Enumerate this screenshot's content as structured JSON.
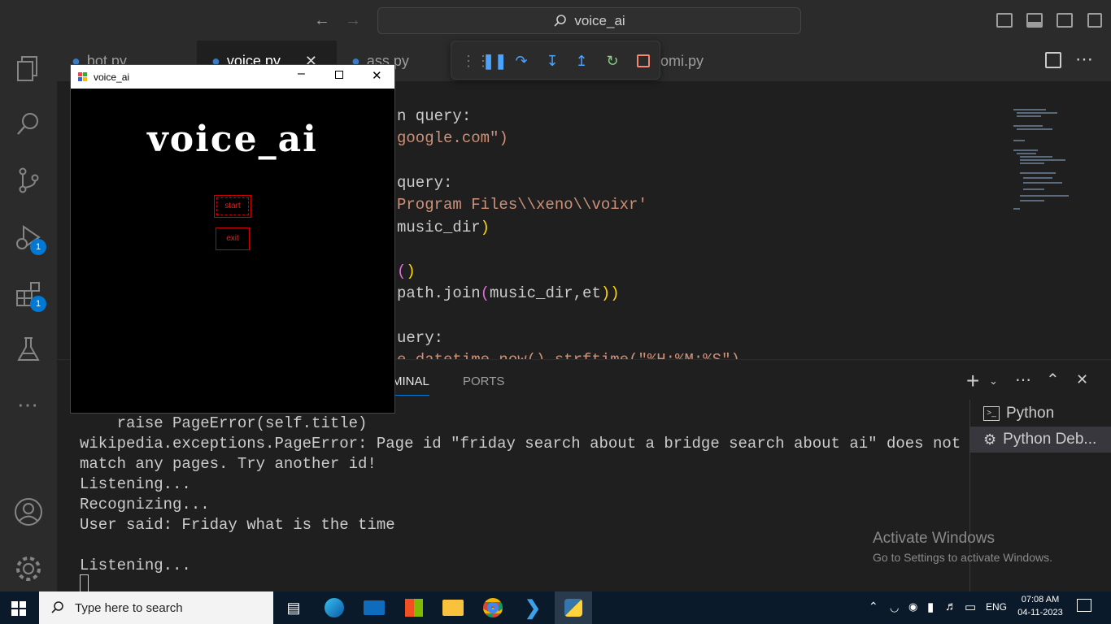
{
  "window_title": "voice_ai",
  "tabs": [
    {
      "label": "bot.py"
    },
    {
      "label": "voice.py"
    },
    {
      "label": "ass.py"
    },
    {
      "label": "omi.py"
    }
  ],
  "editor_lines": [
    {
      "parts": [
        {
          "t": "n query:",
          "c": "w"
        }
      ]
    },
    {
      "parts": [
        {
          "t": "google.com\")",
          "c": "s"
        }
      ]
    },
    {
      "parts": [
        {
          "t": "",
          "c": "w"
        }
      ]
    },
    {
      "parts": [
        {
          "t": "query:",
          "c": "w"
        }
      ]
    },
    {
      "parts": [
        {
          "t": "Program Files\\\\xeno\\\\voixr'",
          "c": "s"
        }
      ]
    },
    {
      "parts": [
        {
          "t": "music_dir",
          "c": "w"
        },
        {
          "t": ")",
          "c": "y"
        }
      ]
    },
    {
      "parts": [
        {
          "t": "",
          "c": "w"
        }
      ]
    },
    {
      "parts": [
        {
          "t": "(",
          "c": "p"
        },
        {
          "t": ")",
          "c": "y"
        }
      ]
    },
    {
      "parts": [
        {
          "t": "path.join",
          "c": "w"
        },
        {
          "t": "(",
          "c": "p"
        },
        {
          "t": "music_dir,et",
          "c": "w"
        },
        {
          "t": "))",
          "c": "y"
        }
      ]
    },
    {
      "parts": [
        {
          "t": "",
          "c": "w"
        }
      ]
    },
    {
      "parts": [
        {
          "t": "uery:",
          "c": "w"
        }
      ]
    },
    {
      "parts": [
        {
          "t": "e.datetime.now().strftime(\"%H:%M:%S\")",
          "c": "s"
        }
      ]
    }
  ],
  "panel": {
    "tab_terminal": "MINAL",
    "tab_ports": "PORTS",
    "terminal_lines": [
      "    raise PageError(self.title)",
      "wikipedia.exceptions.PageError: Page id \"friday search about a bridge search about ai\" does not",
      "match any pages. Try another id!",
      "Listening...",
      "Recognizing...",
      "User said: Friday what is the time",
      "",
      "Listening..."
    ],
    "terminals": [
      {
        "label": "Python",
        "icon": "terminal-icon"
      },
      {
        "label": "Python Deb...",
        "icon": "bug-icon"
      }
    ]
  },
  "activity_badges": {
    "run_debug": "1",
    "extensions": "1"
  },
  "app": {
    "title": "voice_ai",
    "logo_text": "voice_ai",
    "start_label": "start",
    "exit_label": "exit"
  },
  "watermark": {
    "title": "Activate Windows",
    "subtitle": "Go to Settings to activate Windows."
  },
  "taskbar": {
    "search_placeholder": "Type here to search",
    "language": "ENG",
    "time": "07:08 AM",
    "date": "04-11-2023"
  },
  "colors": {
    "accent": "#0078d4",
    "app_button": "#cc0000",
    "string": "#ce9178",
    "bracket": "#ffd700"
  }
}
